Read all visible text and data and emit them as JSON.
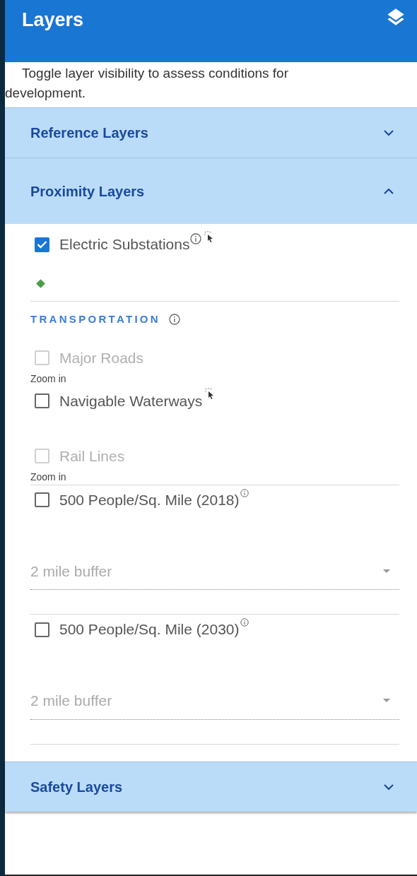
{
  "header": {
    "title": "Layers"
  },
  "description": "Toggle layer visibility to assess conditions for development.",
  "sections": [
    {
      "title": "Reference Layers",
      "expanded": false
    },
    {
      "title": "Proximity Layers",
      "expanded": true,
      "groups": [
        {
          "items": [
            {
              "kind": "layer",
              "label": "Electric Substations",
              "checked": true,
              "disabled": false,
              "info": true,
              "clickable": true,
              "legend": {
                "color": "#4a9e4a"
              }
            }
          ]
        },
        {
          "items": [
            {
              "kind": "heading",
              "text": "TRANSPORTATION",
              "info": true
            },
            {
              "kind": "layer",
              "label": "Major Roads",
              "checked": false,
              "disabled": true,
              "info": false,
              "clickable": false,
              "note": "Zoom in"
            },
            {
              "kind": "layer",
              "label": "Navigable Waterways",
              "checked": false,
              "disabled": false,
              "info": false,
              "clickable": true
            },
            {
              "kind": "layer",
              "label": "Rail Lines",
              "checked": false,
              "disabled": true,
              "info": false,
              "clickable": false,
              "note": "Zoom in"
            }
          ]
        },
        {
          "items": [
            {
              "kind": "layer",
              "label": "500 People/Sq. Mile (2018)",
              "checked": false,
              "disabled": false,
              "info": true,
              "clickable": false
            },
            {
              "kind": "select",
              "placeholder": "2 mile buffer"
            }
          ]
        },
        {
          "items": [
            {
              "kind": "layer",
              "label": "500 People/Sq. Mile (2030)",
              "checked": false,
              "disabled": false,
              "info": true,
              "clickable": false
            },
            {
              "kind": "select",
              "placeholder": "2 mile buffer"
            }
          ]
        }
      ]
    },
    {
      "title": "Safety Layers",
      "expanded": false
    }
  ]
}
